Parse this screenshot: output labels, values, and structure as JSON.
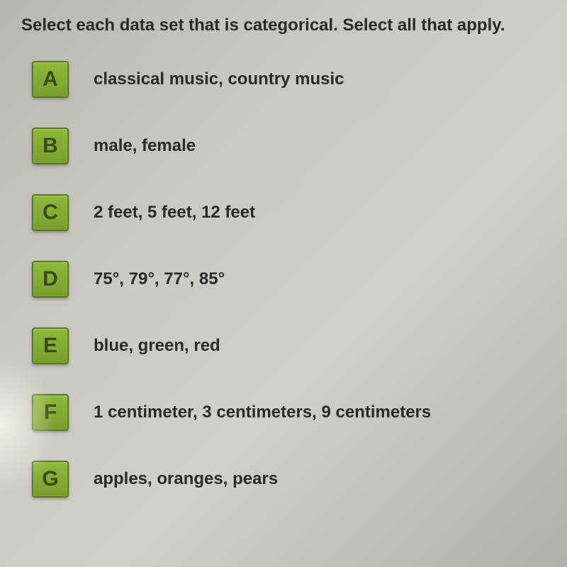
{
  "question": {
    "text": "Select each data set that is categorical. Select all that apply."
  },
  "options": [
    {
      "letter": "A",
      "text": "classical music, country music"
    },
    {
      "letter": "B",
      "text": "male, female"
    },
    {
      "letter": "C",
      "text": "2 feet, 5 feet, 12 feet"
    },
    {
      "letter": "D",
      "text": "75°, 79°, 77°, 85°"
    },
    {
      "letter": "E",
      "text": "blue, green, red"
    },
    {
      "letter": "F",
      "text": "1 centimeter, 3 centimeters, 9 centimeters"
    },
    {
      "letter": "G",
      "text": "apples, oranges, pears"
    }
  ]
}
